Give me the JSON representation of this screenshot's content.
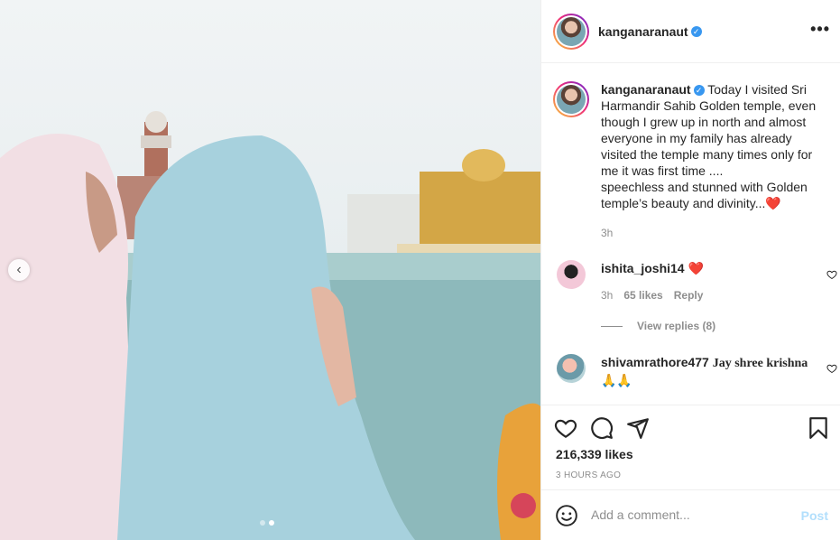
{
  "post": {
    "username": "kanganaranaut",
    "verified_mark": "✓",
    "more_label": "•••",
    "caption": "Today I visited Sri Harmandir Sahib Golden temple, even though I grew up in north and almost everyone in my family has already visited the temple many times only for me it was first time ....\nspeechless and stunned with Golden temple’s beauty and divinity...❤️",
    "caption_time": "3h",
    "likes": "216,339 likes",
    "posted_ago": "3 HOURS AGO"
  },
  "photo": {
    "prev_arrow": "‹",
    "slide_count": 2,
    "active_slide": 2
  },
  "comments": [
    {
      "username": "ishita_joshi14",
      "text": "❤️",
      "time": "3h",
      "likes": "65 likes",
      "reply_label": "Reply",
      "view_replies": "View replies (8)"
    },
    {
      "username": "shivamrathore477",
      "text": "Jay shree krishna 🙏🙏"
    }
  ],
  "composer": {
    "placeholder": "Add a comment...",
    "post_label": "Post"
  },
  "colors": {
    "accent_blue": "#3897f0",
    "post_disabled": "#b2dffc",
    "muted_text": "#8e8e8e",
    "like_red": "#ed4956"
  },
  "icons": [
    "heart-icon",
    "comment-icon",
    "share-icon",
    "bookmark-icon",
    "emoji-icon",
    "more-icon",
    "verified-icon"
  ]
}
